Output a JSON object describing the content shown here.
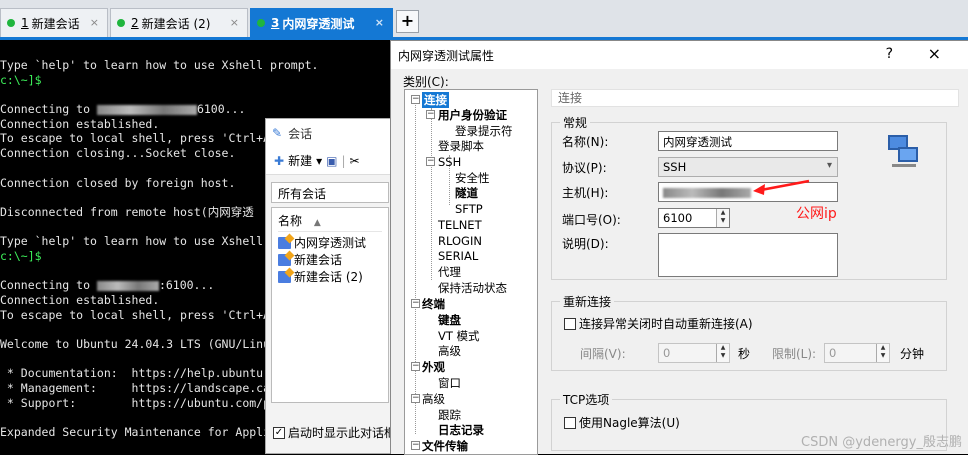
{
  "tabs": [
    {
      "num": "1",
      "label": "新建会话",
      "close": "×"
    },
    {
      "num": "2",
      "label": "新建会话 (2)",
      "close": "×"
    },
    {
      "num": "3",
      "label": "内网穿透测试",
      "close": "×"
    }
  ],
  "add_tab_label": "+",
  "terminal": {
    "lines": [
      "Type `help' to learn how to use Xshell prompt.",
      "c:\\~]$",
      "",
      "Connecting to ",
      "Connection established.",
      "To escape to local shell, press 'Ctrl+Al",
      "Connection closing...Socket close.",
      "",
      "Connection closed by foreign host.",
      "",
      "Disconnected from remote host(内网穿透",
      "",
      "Type `help' to learn how to use Xshell",
      "c:\\~]$",
      "",
      "Connecting to ",
      "Connection established.",
      "To escape to local shell, press 'Ctrl+Al",
      "",
      "Welcome to Ubuntu 24.04.3 LTS (GNU/Linu",
      "",
      " * Documentation:  https://help.ubuntu.",
      " * Management:     https://landscape.ca",
      " * Support:        https://ubuntu.com/p",
      "",
      "Expanded Security Maintenance for Appli"
    ],
    "connect_suffix_1": "6100...",
    "connect_suffix_2": ":6100..."
  },
  "session_window": {
    "title": "会话",
    "new_label": "新建",
    "path": "所有会话",
    "name_header": "名称",
    "items": [
      "内网穿透测试",
      "新建会话",
      "新建会话 (2)"
    ],
    "startup_label": "启动时显示此对话框"
  },
  "dialog": {
    "title": "内网穿透测试属性",
    "help": "?",
    "close": "×",
    "category_label": "类别(C):",
    "tree": [
      "连接",
      "用户身份验证",
      "登录提示符",
      "登录脚本",
      "SSH",
      "安全性",
      "隧道",
      "SFTP",
      "TELNET",
      "RLOGIN",
      "SERIAL",
      "代理",
      "保持活动状态",
      "终端",
      "键盘",
      "VT 模式",
      "高级",
      "外观",
      "窗口",
      "高级",
      "跟踪",
      "日志记录",
      "文件传输"
    ],
    "section_title": "连接",
    "general_group": "常规",
    "name_label": "名称(N):",
    "name_value": "内网穿透测试",
    "protocol_label": "协议(P):",
    "protocol_value": "SSH",
    "host_label": "主机(H):",
    "port_label": "端口号(O):",
    "port_value": "6100",
    "desc_label": "说明(D):",
    "reconnect_group": "重新连接",
    "reconnect_check": "连接异常关闭时自动重新连接(A)",
    "interval_label": "间隔(V):",
    "interval_value": "0",
    "seconds_label": "秒",
    "limit_label": "限制(L):",
    "limit_value": "0",
    "minutes_label": "分钟",
    "tcp_group": "TCP选项",
    "nagle_check": "使用Nagle算法(U)"
  },
  "annotation": "公网ip",
  "watermark": "CSDN @ydenergy_殷志鹏",
  "colors": {
    "accent": "#1478d4",
    "prompt": "#3df05a",
    "annotation": "#ff1a1a"
  }
}
